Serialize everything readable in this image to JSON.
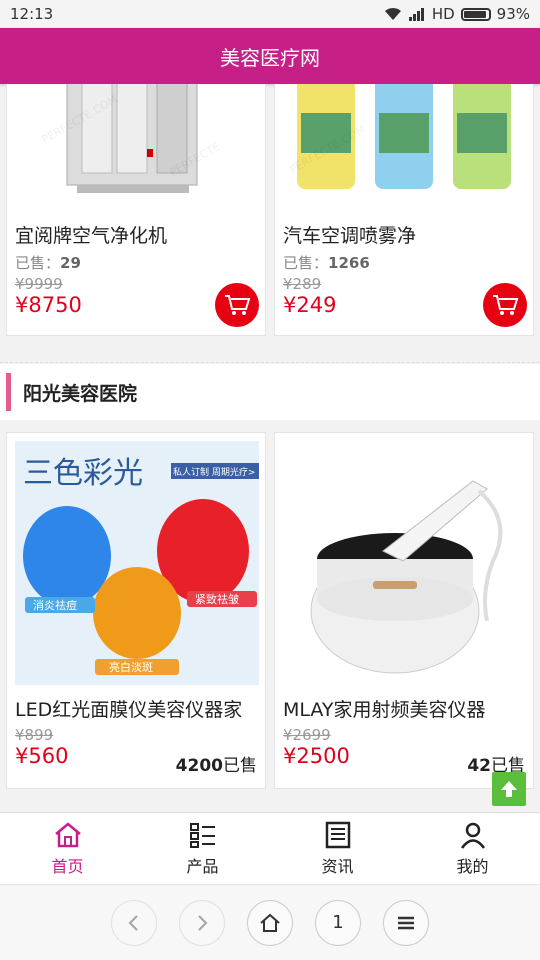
{
  "status": {
    "time": "12:13",
    "network": "HD",
    "battery": "93%",
    "battery_level": 0.93
  },
  "header": {
    "title": "美容医疗网"
  },
  "section1": {
    "products": [
      {
        "name": "宜阅牌空气净化机",
        "sold_label": "已售：",
        "sold": "29",
        "old_price": "¥9999",
        "price": "¥8750"
      },
      {
        "name": "汽车空调喷雾净",
        "sold_label": "已售：",
        "sold": "1266",
        "old_price": "¥289",
        "price": "¥249"
      }
    ]
  },
  "section2": {
    "title": "阳光美容医院",
    "products": [
      {
        "name": "LED红光面膜仪美容仪器家",
        "old_price": "¥899",
        "price": "¥560",
        "sold": "4200",
        "sold_suffix": "已售",
        "img_text": {
          "title": "三色彩光",
          "banner": "私人订制 周期光疗>",
          "tag1": "消炎祛痘",
          "tag2": "紧致祛皱",
          "tag3": "亮白淡斑"
        }
      },
      {
        "name": "MLAY家用射频美容仪器",
        "old_price": "¥2699",
        "price": "¥2500",
        "sold": "42",
        "sold_suffix": "已售"
      }
    ]
  },
  "tabs": [
    {
      "label": "首页",
      "icon": "home-icon",
      "active": true
    },
    {
      "label": "产品",
      "icon": "list-icon",
      "active": false
    },
    {
      "label": "资讯",
      "icon": "news-icon",
      "active": false
    },
    {
      "label": "我的",
      "icon": "user-icon",
      "active": false
    }
  ],
  "browser": {
    "page_number": "1"
  },
  "colors": {
    "brand": "#c71f88",
    "price": "#e0001b",
    "cart": "#e60012",
    "to_top": "#5bbd3c"
  }
}
